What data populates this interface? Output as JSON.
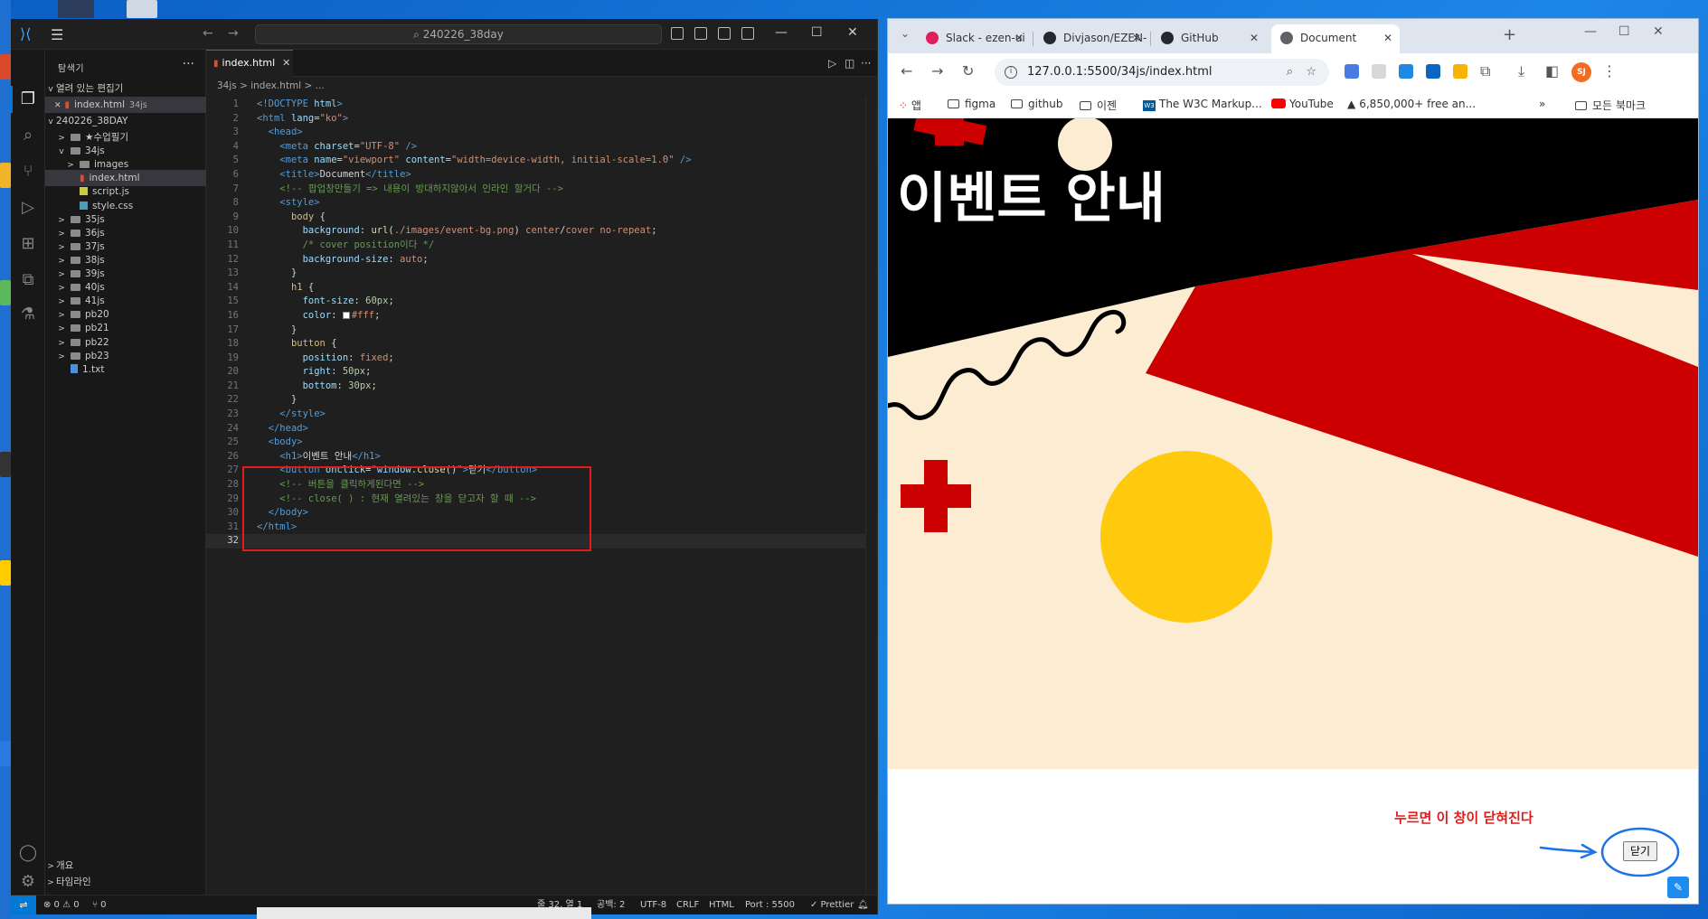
{
  "vscode": {
    "search": "240226_38day",
    "sidebar": {
      "title": "탐색기",
      "open_editors_label": "열려 있는 편집기",
      "open_file": "index.html",
      "open_file_folder": "34js",
      "workspace": "240226_38DAY",
      "tree": [
        {
          "name": "★수업필기",
          "type": "folder",
          "depth": 1,
          "chev": ">"
        },
        {
          "name": "34js",
          "type": "folder",
          "depth": 1,
          "chev": "v"
        },
        {
          "name": "images",
          "type": "folder",
          "depth": 2,
          "chev": ">"
        },
        {
          "name": "index.html",
          "type": "html",
          "depth": 2,
          "chev": ""
        },
        {
          "name": "script.js",
          "type": "js",
          "depth": 2,
          "chev": ""
        },
        {
          "name": "style.css",
          "type": "css",
          "depth": 2,
          "chev": ""
        },
        {
          "name": "35js",
          "type": "folder",
          "depth": 1,
          "chev": ">"
        },
        {
          "name": "36js",
          "type": "folder",
          "depth": 1,
          "chev": ">"
        },
        {
          "name": "37js",
          "type": "folder",
          "depth": 1,
          "chev": ">"
        },
        {
          "name": "38js",
          "type": "folder",
          "depth": 1,
          "chev": ">"
        },
        {
          "name": "39js",
          "type": "folder",
          "depth": 1,
          "chev": ">"
        },
        {
          "name": "40js",
          "type": "folder",
          "depth": 1,
          "chev": ">"
        },
        {
          "name": "41js",
          "type": "folder",
          "depth": 1,
          "chev": ">"
        },
        {
          "name": "pb20",
          "type": "folder",
          "depth": 1,
          "chev": ">"
        },
        {
          "name": "pb21",
          "type": "folder",
          "depth": 1,
          "chev": ">"
        },
        {
          "name": "pb22",
          "type": "folder",
          "depth": 1,
          "chev": ">"
        },
        {
          "name": "pb23",
          "type": "folder",
          "depth": 1,
          "chev": ">"
        },
        {
          "name": "1.txt",
          "type": "txt",
          "depth": 1,
          "chev": ""
        }
      ],
      "outline_label": "개요",
      "timeline_label": "타임라인"
    },
    "tab": "index.html",
    "breadcrumb": "34js  >  index.html  > ...",
    "status": {
      "errors": "⊗ 0 ⚠ 0",
      "ports": "⑂ 0",
      "position": "줄 32, 열 1",
      "spaces": "공백: 2",
      "encoding": "UTF-8",
      "eol": "CRLF",
      "language": "HTML",
      "port": "Port : 5500",
      "prettier": "✓ Prettier"
    }
  },
  "chrome": {
    "tabs": [
      {
        "title": "Slack - ezen-ui",
        "color": "#e01e5a"
      },
      {
        "title": "Divjason/EZEN-",
        "color": "#24292f"
      },
      {
        "title": "GitHub",
        "color": "#24292f"
      },
      {
        "title": "Document",
        "color": "#5f6368"
      }
    ],
    "url": "127.0.0.1:5500/34js/index.html",
    "avatar": "SJ",
    "bookmarks": [
      "앱",
      "figma",
      "github",
      "이젠",
      "The W3C Markup...",
      "YouTube",
      "6,850,000+ free an...",
      "모든 북마크"
    ],
    "page": {
      "h1": "이벤트 안내",
      "annotation": "누르면 이 창이 닫혀진다",
      "close_button": "닫기"
    }
  }
}
